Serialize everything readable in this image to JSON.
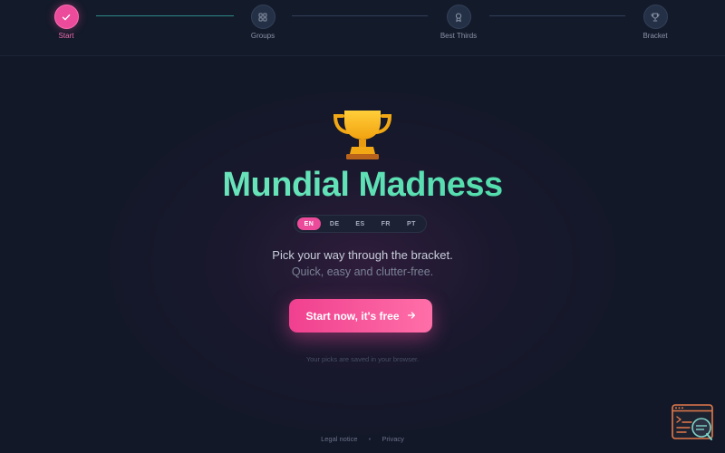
{
  "stepper": {
    "steps": [
      {
        "label": "Start",
        "icon": "check-icon",
        "state": "active"
      },
      {
        "label": "Groups",
        "icon": "grid-icon",
        "state": "pending"
      },
      {
        "label": "Best Thirds",
        "icon": "award-icon",
        "state": "pending"
      },
      {
        "label": "Bracket",
        "icon": "trophy-icon",
        "state": "pending"
      }
    ]
  },
  "hero": {
    "icon": "trophy-icon",
    "title": "Mundial Madness",
    "languages": [
      "EN",
      "DE",
      "ES",
      "FR",
      "PT"
    ],
    "selected_language": "EN",
    "tagline": "Pick your way through the bracket.",
    "subtagline": "Quick, easy and clutter-free.",
    "cta_label": "Start now, it's free",
    "cta_icon": "arrow-right-icon",
    "saved_note": "Your picks are saved in your browser."
  },
  "footer": {
    "legal_label": "Legal notice",
    "separator": "•",
    "privacy_label": "Privacy"
  },
  "colors": {
    "background": "#121828",
    "accent_pink": "#ec4a9a",
    "title_green": "#5de3b3",
    "connector_done": "#2c8a88"
  }
}
